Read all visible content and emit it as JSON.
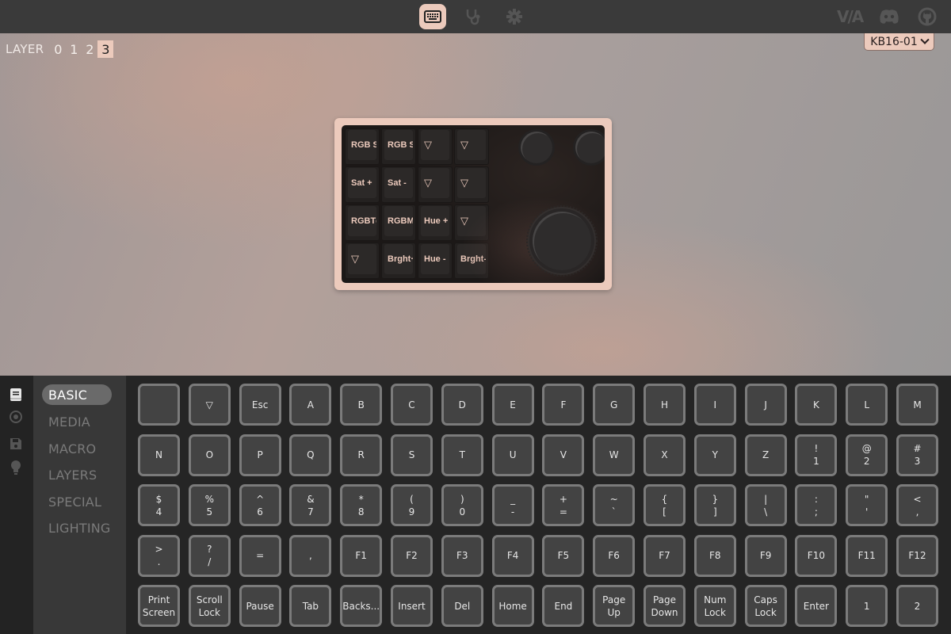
{
  "topbar": {
    "nav": [
      {
        "name": "keyboard-icon",
        "label": "Configure",
        "active": true
      },
      {
        "name": "stethoscope-icon",
        "label": "Key Tester",
        "active": false
      },
      {
        "name": "gear-icon",
        "label": "Settings",
        "active": false
      }
    ],
    "external": {
      "via_logo": "V/A",
      "discord": "discord-icon",
      "github": "github-icon"
    }
  },
  "colors": {
    "accent": "#eccabc",
    "topbar_bg": "#3a3a3a",
    "panel_bg": "#252525",
    "key_bg": "#434343",
    "key_border": "#7b7b7b"
  },
  "layers": {
    "label": "LAYER",
    "items": [
      "0",
      "1",
      "2",
      "3"
    ],
    "active_index": 3
  },
  "device_selector": {
    "value": "KB16-01"
  },
  "device": {
    "keys": [
      [
        "RGB Sl",
        "RGB Sl",
        "▽",
        "▽"
      ],
      [
        "Sat +",
        "Sat -",
        "▽",
        "▽"
      ],
      [
        "RGBTg",
        "RGBMo",
        "Hue +",
        "▽"
      ],
      [
        "▽",
        "Brght+",
        "Hue -",
        "Brght-"
      ]
    ],
    "knobs": [
      "knob-1",
      "knob-2",
      "knob-main"
    ]
  },
  "sidebar": {
    "icons": [
      {
        "name": "keycode-book-icon",
        "active": true
      },
      {
        "name": "record-icon",
        "active": false
      },
      {
        "name": "save-icon",
        "active": false
      },
      {
        "name": "lightbulb-icon",
        "active": false
      }
    ],
    "categories": [
      "BASIC",
      "MEDIA",
      "MACRO",
      "LAYERS",
      "SPECIAL",
      "LIGHTING"
    ],
    "active_category": 0
  },
  "keycodes": [
    [
      "",
      "▽",
      "Esc",
      "A",
      "B",
      "C",
      "D",
      "E",
      "F",
      "G",
      "H",
      "I",
      "J",
      "K",
      "L",
      "M"
    ],
    [
      "N",
      "O",
      "P",
      "Q",
      "R",
      "S",
      "T",
      "U",
      "V",
      "W",
      "X",
      "Y",
      "Z",
      "!\n1",
      "@\n2",
      "#\n3"
    ],
    [
      "$\n4",
      "%\n5",
      "^\n6",
      "&\n7",
      "*\n8",
      "(\n9",
      ")\n0",
      "_\n-",
      "+\n=",
      "~\n`",
      "{\n[",
      "}\n]",
      "|\n\\",
      ":\n;",
      "\"\n'",
      "<\n,"
    ],
    [
      ">\n.",
      "?\n/",
      "=",
      ",",
      "F1",
      "F2",
      "F3",
      "F4",
      "F5",
      "F6",
      "F7",
      "F8",
      "F9",
      "F10",
      "F11",
      "F12"
    ],
    [
      "Print\nScreen",
      "Scroll\nLock",
      "Pause",
      "Tab",
      "Backs...",
      "Insert",
      "Del",
      "Home",
      "End",
      "Page\nUp",
      "Page\nDown",
      "Num\nLock",
      "Caps\nLock",
      "Enter",
      "1",
      "2"
    ]
  ]
}
